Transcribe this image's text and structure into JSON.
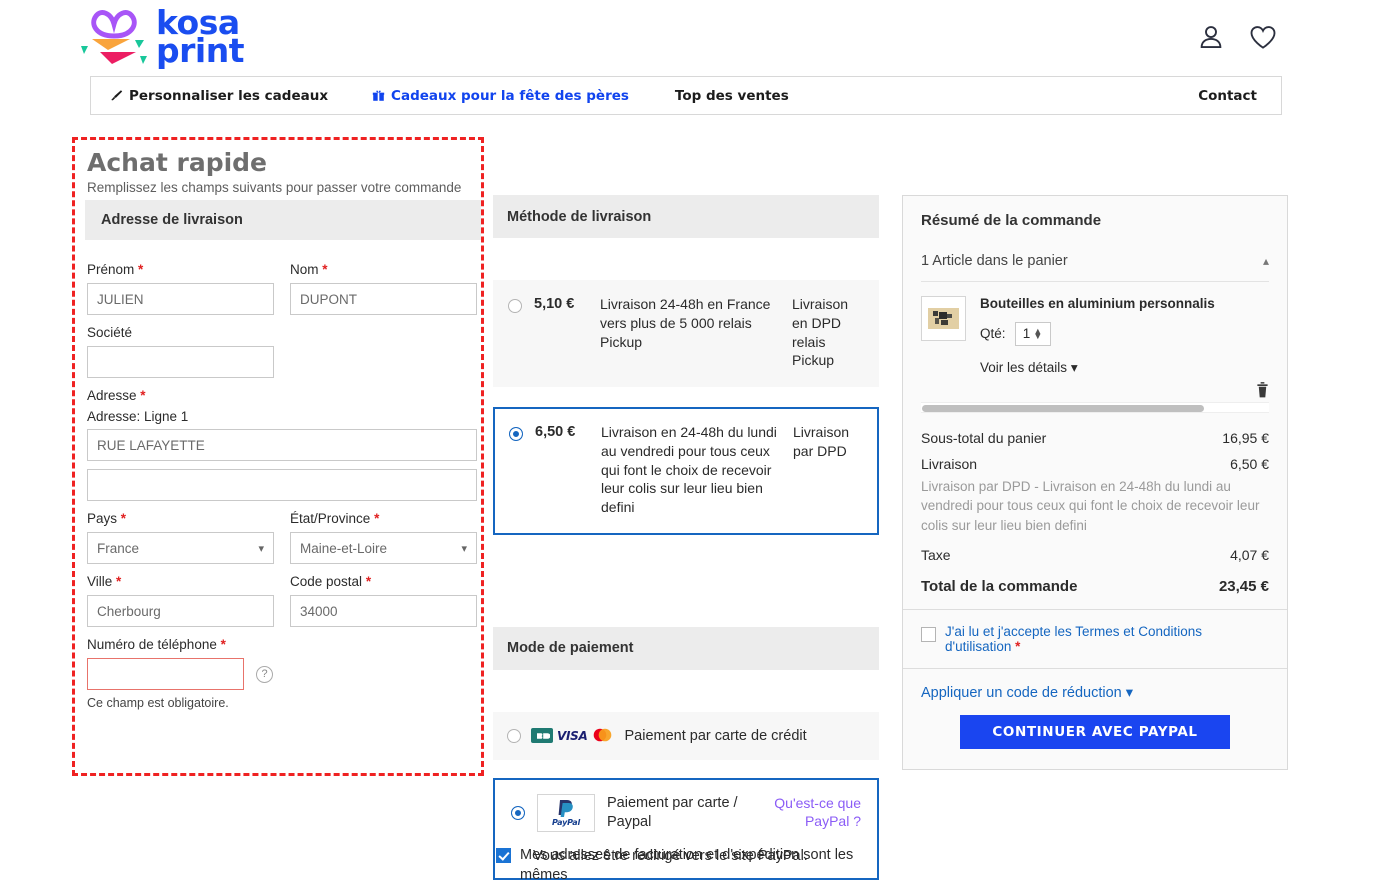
{
  "header": {
    "logo_line1": "kosa",
    "logo_line2": "print",
    "account_icon": "user-icon",
    "wishlist_icon": "heart-icon"
  },
  "nav": {
    "items": [
      {
        "label": "Personnaliser les cadeaux",
        "icon": "brush-icon"
      },
      {
        "label": "Cadeaux pour la fête des pères",
        "icon": "gift-icon"
      },
      {
        "label": "Top des ventes",
        "icon": ""
      },
      {
        "label": "Contact",
        "icon": ""
      }
    ]
  },
  "quick_buy": {
    "title": "Achat rapide",
    "subtitle": "Remplissez les champs suivants pour passer votre commande",
    "section_header": "Adresse de livraison",
    "fields": {
      "firstname_label": "Prénom",
      "firstname_value": "JULIEN",
      "lastname_label": "Nom",
      "lastname_value": "DUPONT",
      "company_label": "Société",
      "company_value": "",
      "address_label": "Adresse",
      "address_line1_label": "Adresse: Ligne 1",
      "address_line1_value": "RUE LAFAYETTE",
      "address_line2_value": "",
      "country_label": "Pays",
      "country_value": "France",
      "state_label": "État/Province",
      "state_value": "Maine-et-Loire",
      "city_label": "Ville",
      "city_value": "Cherbourg",
      "postal_label": "Code postal",
      "postal_value": "34000",
      "phone_label": "Numéro de téléphone",
      "phone_value": "",
      "phone_error": "Ce champ est obligatoire.",
      "help_icon": "question-mark-icon"
    },
    "required_mark": "*"
  },
  "delivery": {
    "header": "Méthode de livraison",
    "options": [
      {
        "price": "5,10 €",
        "description": "Livraison 24-48h en France vers plus de 5 000 relais Pickup",
        "carrier": "Livraison en DPD relais Pickup",
        "selected": false
      },
      {
        "price": "6,50 €",
        "description": "Livraison en 24-48h du lundi au vendredi pour tous ceux qui font le choix de recevoir leur colis sur leur lieu bien defini",
        "carrier": "Livraison par DPD",
        "selected": true
      }
    ]
  },
  "payment": {
    "header": "Mode de paiement",
    "card_option": {
      "label": "Paiement par carte de crédit",
      "icons": [
        "cb-card-icon",
        "visa-icon",
        "mastercard-icon"
      ],
      "visa_text": "VISA",
      "cb_text": "CB",
      "selected": false
    },
    "paypal_option": {
      "label": "Paiement par carte / Paypal",
      "link": "Qu'est-ce que PayPal ?",
      "note": "Vous allez être redirigé vers le site PayPal.",
      "logo_text": "PayPal",
      "selected": true
    },
    "same_address_label": "Mes adresses de facturation et d'expédition sont les mêmes",
    "same_address_checked": true
  },
  "summary": {
    "header": "Résumé de la commande",
    "cart_line": "1 Article dans le panier",
    "collapse_icon": "chevron-up-icon",
    "item": {
      "name": "Bouteilles en aluminium personnalis",
      "qty_label": "Qté:",
      "qty_value": "1",
      "details_link": "Voir les détails",
      "thumbnail_icon": "product-thumbnail"
    },
    "delete_icon": "trash-icon",
    "totals": [
      {
        "label": "Sous-total du panier",
        "value": "16,95 €"
      },
      {
        "label": "Livraison",
        "value": "6,50 €"
      },
      {
        "label": "Taxe",
        "value": "4,07 €"
      }
    ],
    "shipping_note": "Livraison par DPD - Livraison en 24-48h du lundi au vendredi pour tous ceux qui font le choix de recevoir leur colis sur leur lieu bien defini",
    "grand_total_label": "Total de la commande",
    "grand_total_value": "23,45 €",
    "terms_label": "J'ai lu et j'accepte les Termes et Conditions d'utilisation",
    "terms_required": "*",
    "terms_checked": false,
    "promo_label": "Appliquer un code de réduction",
    "cta_label": "CONTINUER AVEC PAYPAL"
  },
  "colors": {
    "brand_blue": "#1a4df0",
    "link_blue": "#1566c0",
    "selected_border": "#1566c0",
    "required_red": "#e02020",
    "highlight_dashed": "#ef2222",
    "paypal_purple": "#8b5cf6",
    "section_bg": "#ececec"
  }
}
